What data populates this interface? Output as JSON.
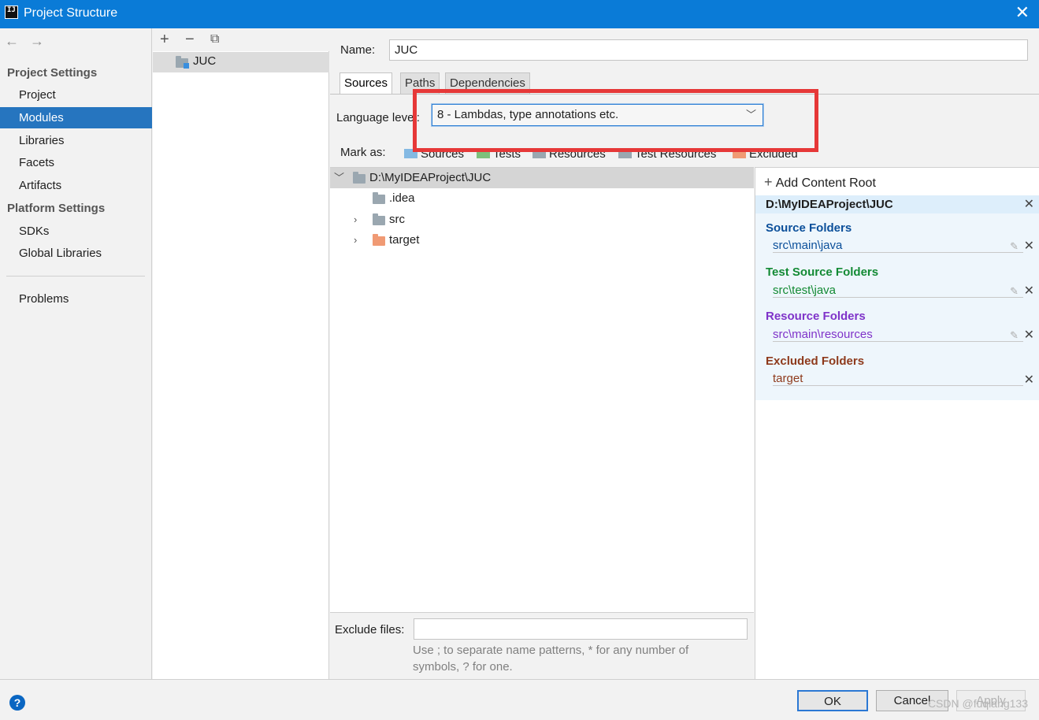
{
  "window": {
    "title": "Project Structure"
  },
  "nav": {
    "groups": [
      "Project Settings",
      "Platform Settings"
    ],
    "project_settings": [
      "Project",
      "Modules",
      "Libraries",
      "Facets",
      "Artifacts"
    ],
    "platform_settings": [
      "SDKs",
      "Global Libraries"
    ],
    "problems": "Problems",
    "selected": "Modules"
  },
  "modules": {
    "items": [
      "JUC"
    ]
  },
  "module": {
    "name_label": "Name:",
    "name_value": "JUC",
    "tabs": [
      "Sources",
      "Paths",
      "Dependencies"
    ],
    "language_level_label": "Language level:",
    "language_level_value": "8 - Lambdas, type annotations etc.",
    "mark_as_label": "Mark as:",
    "mark_as": [
      {
        "label": "Sources",
        "color": "#84b9e3"
      },
      {
        "label": "Tests",
        "color": "#7cc07b"
      },
      {
        "label": "Resources",
        "color": "#9aa7b0"
      },
      {
        "label": "Test Resources",
        "color": "#9aa7b0"
      },
      {
        "label": "Excluded",
        "color": "#f09a74"
      }
    ],
    "tree": {
      "root": "D:\\MyIDEAProject\\JUC",
      "children": [
        ".idea",
        "src",
        "target"
      ]
    },
    "exclude_files_label": "Exclude files:",
    "exclude_hint_line1": "Use ; to separate name patterns, * for any number of",
    "exclude_hint_line2": "symbols, ? for one."
  },
  "content_roots": {
    "add_label": "Add Content Root",
    "root_path": "D:\\MyIDEAProject\\JUC",
    "sections": [
      {
        "title": "Source Folders",
        "path": "src\\main\\java",
        "color": "#0b4f9a"
      },
      {
        "title": "Test Source Folders",
        "path": "src\\test\\java",
        "color": "#138a34"
      },
      {
        "title": "Resource Folders",
        "path": "src\\main\\resources",
        "color": "#7f33c9"
      },
      {
        "title": "Excluded Folders",
        "path": "target",
        "color": "#8e3a1c"
      }
    ]
  },
  "footer": {
    "ok": "OK",
    "cancel": "Cancel",
    "apply": "Apply",
    "help": "?",
    "watermark": "CSDN @fuqiang133"
  }
}
